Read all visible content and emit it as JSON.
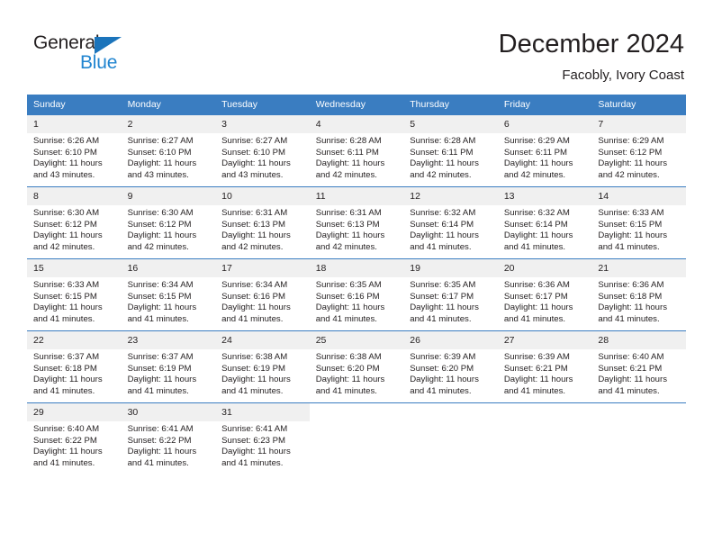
{
  "logo": {
    "word1": "General",
    "word2": "Blue",
    "triangle_color": "#1b74bb",
    "word2_color": "#2185d0"
  },
  "header": {
    "title": "December 2024",
    "subtitle": "Facobly, Ivory Coast"
  },
  "colors": {
    "header_bg": "#3a7dc1",
    "daynum_bg": "#f0f0f0",
    "text": "#231f20",
    "border": "#3a7dc1"
  },
  "calendar": {
    "weekday_headers": [
      "Sunday",
      "Monday",
      "Tuesday",
      "Wednesday",
      "Thursday",
      "Friday",
      "Saturday"
    ],
    "weeks": [
      [
        {
          "day": "1",
          "sunrise": "Sunrise: 6:26 AM",
          "sunset": "Sunset: 6:10 PM",
          "daylight": "Daylight: 11 hours and 43 minutes."
        },
        {
          "day": "2",
          "sunrise": "Sunrise: 6:27 AM",
          "sunset": "Sunset: 6:10 PM",
          "daylight": "Daylight: 11 hours and 43 minutes."
        },
        {
          "day": "3",
          "sunrise": "Sunrise: 6:27 AM",
          "sunset": "Sunset: 6:10 PM",
          "daylight": "Daylight: 11 hours and 43 minutes."
        },
        {
          "day": "4",
          "sunrise": "Sunrise: 6:28 AM",
          "sunset": "Sunset: 6:11 PM",
          "daylight": "Daylight: 11 hours and 42 minutes."
        },
        {
          "day": "5",
          "sunrise": "Sunrise: 6:28 AM",
          "sunset": "Sunset: 6:11 PM",
          "daylight": "Daylight: 11 hours and 42 minutes."
        },
        {
          "day": "6",
          "sunrise": "Sunrise: 6:29 AM",
          "sunset": "Sunset: 6:11 PM",
          "daylight": "Daylight: 11 hours and 42 minutes."
        },
        {
          "day": "7",
          "sunrise": "Sunrise: 6:29 AM",
          "sunset": "Sunset: 6:12 PM",
          "daylight": "Daylight: 11 hours and 42 minutes."
        }
      ],
      [
        {
          "day": "8",
          "sunrise": "Sunrise: 6:30 AM",
          "sunset": "Sunset: 6:12 PM",
          "daylight": "Daylight: 11 hours and 42 minutes."
        },
        {
          "day": "9",
          "sunrise": "Sunrise: 6:30 AM",
          "sunset": "Sunset: 6:12 PM",
          "daylight": "Daylight: 11 hours and 42 minutes."
        },
        {
          "day": "10",
          "sunrise": "Sunrise: 6:31 AM",
          "sunset": "Sunset: 6:13 PM",
          "daylight": "Daylight: 11 hours and 42 minutes."
        },
        {
          "day": "11",
          "sunrise": "Sunrise: 6:31 AM",
          "sunset": "Sunset: 6:13 PM",
          "daylight": "Daylight: 11 hours and 42 minutes."
        },
        {
          "day": "12",
          "sunrise": "Sunrise: 6:32 AM",
          "sunset": "Sunset: 6:14 PM",
          "daylight": "Daylight: 11 hours and 41 minutes."
        },
        {
          "day": "13",
          "sunrise": "Sunrise: 6:32 AM",
          "sunset": "Sunset: 6:14 PM",
          "daylight": "Daylight: 11 hours and 41 minutes."
        },
        {
          "day": "14",
          "sunrise": "Sunrise: 6:33 AM",
          "sunset": "Sunset: 6:15 PM",
          "daylight": "Daylight: 11 hours and 41 minutes."
        }
      ],
      [
        {
          "day": "15",
          "sunrise": "Sunrise: 6:33 AM",
          "sunset": "Sunset: 6:15 PM",
          "daylight": "Daylight: 11 hours and 41 minutes."
        },
        {
          "day": "16",
          "sunrise": "Sunrise: 6:34 AM",
          "sunset": "Sunset: 6:15 PM",
          "daylight": "Daylight: 11 hours and 41 minutes."
        },
        {
          "day": "17",
          "sunrise": "Sunrise: 6:34 AM",
          "sunset": "Sunset: 6:16 PM",
          "daylight": "Daylight: 11 hours and 41 minutes."
        },
        {
          "day": "18",
          "sunrise": "Sunrise: 6:35 AM",
          "sunset": "Sunset: 6:16 PM",
          "daylight": "Daylight: 11 hours and 41 minutes."
        },
        {
          "day": "19",
          "sunrise": "Sunrise: 6:35 AM",
          "sunset": "Sunset: 6:17 PM",
          "daylight": "Daylight: 11 hours and 41 minutes."
        },
        {
          "day": "20",
          "sunrise": "Sunrise: 6:36 AM",
          "sunset": "Sunset: 6:17 PM",
          "daylight": "Daylight: 11 hours and 41 minutes."
        },
        {
          "day": "21",
          "sunrise": "Sunrise: 6:36 AM",
          "sunset": "Sunset: 6:18 PM",
          "daylight": "Daylight: 11 hours and 41 minutes."
        }
      ],
      [
        {
          "day": "22",
          "sunrise": "Sunrise: 6:37 AM",
          "sunset": "Sunset: 6:18 PM",
          "daylight": "Daylight: 11 hours and 41 minutes."
        },
        {
          "day": "23",
          "sunrise": "Sunrise: 6:37 AM",
          "sunset": "Sunset: 6:19 PM",
          "daylight": "Daylight: 11 hours and 41 minutes."
        },
        {
          "day": "24",
          "sunrise": "Sunrise: 6:38 AM",
          "sunset": "Sunset: 6:19 PM",
          "daylight": "Daylight: 11 hours and 41 minutes."
        },
        {
          "day": "25",
          "sunrise": "Sunrise: 6:38 AM",
          "sunset": "Sunset: 6:20 PM",
          "daylight": "Daylight: 11 hours and 41 minutes."
        },
        {
          "day": "26",
          "sunrise": "Sunrise: 6:39 AM",
          "sunset": "Sunset: 6:20 PM",
          "daylight": "Daylight: 11 hours and 41 minutes."
        },
        {
          "day": "27",
          "sunrise": "Sunrise: 6:39 AM",
          "sunset": "Sunset: 6:21 PM",
          "daylight": "Daylight: 11 hours and 41 minutes."
        },
        {
          "day": "28",
          "sunrise": "Sunrise: 6:40 AM",
          "sunset": "Sunset: 6:21 PM",
          "daylight": "Daylight: 11 hours and 41 minutes."
        }
      ],
      [
        {
          "day": "29",
          "sunrise": "Sunrise: 6:40 AM",
          "sunset": "Sunset: 6:22 PM",
          "daylight": "Daylight: 11 hours and 41 minutes."
        },
        {
          "day": "30",
          "sunrise": "Sunrise: 6:41 AM",
          "sunset": "Sunset: 6:22 PM",
          "daylight": "Daylight: 11 hours and 41 minutes."
        },
        {
          "day": "31",
          "sunrise": "Sunrise: 6:41 AM",
          "sunset": "Sunset: 6:23 PM",
          "daylight": "Daylight: 11 hours and 41 minutes."
        },
        {
          "day": "",
          "sunrise": "",
          "sunset": "",
          "daylight": ""
        },
        {
          "day": "",
          "sunrise": "",
          "sunset": "",
          "daylight": ""
        },
        {
          "day": "",
          "sunrise": "",
          "sunset": "",
          "daylight": ""
        },
        {
          "day": "",
          "sunrise": "",
          "sunset": "",
          "daylight": ""
        }
      ]
    ]
  }
}
